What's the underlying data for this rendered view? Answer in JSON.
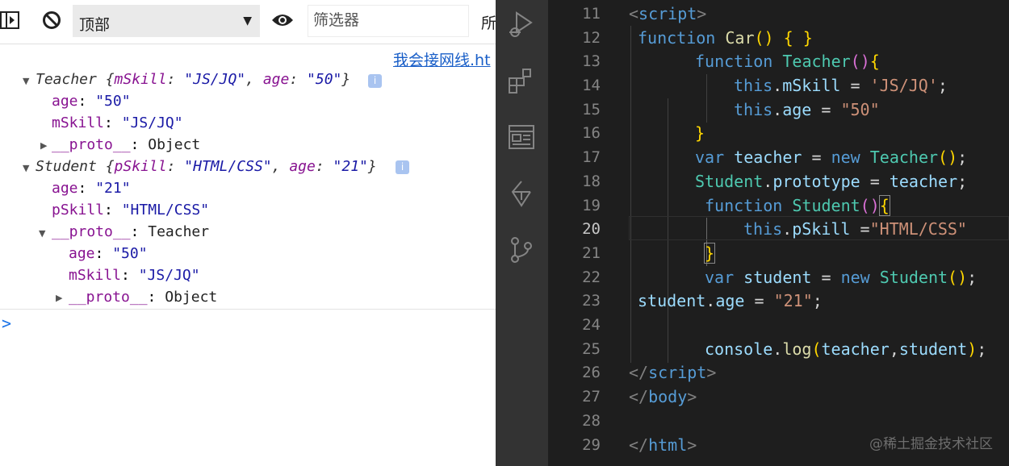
{
  "devtools": {
    "context": "顶部",
    "filter_placeholder": "筛选器",
    "levels_label": "所",
    "source_link": "我会接网线.ht",
    "log": {
      "teacher_summary": {
        "name": "Teacher ",
        "open": "{",
        "k1": "mSkill",
        "v1": "\"JS/JQ\"",
        "k2": "age",
        "v2": "\"50\"",
        "close": "}"
      },
      "teacher_props": [
        {
          "key": "age",
          "value": "\"50\""
        },
        {
          "key": "mSkill",
          "value": "\"JS/JQ\""
        }
      ],
      "teacher_proto": {
        "key": "__proto__",
        "value": "Object"
      },
      "student_summary": {
        "name": "Student ",
        "open": "{",
        "k1": "pSkill",
        "v1": "\"HTML/CSS\"",
        "k2": "age",
        "v2": "\"21\"",
        "close": "}"
      },
      "student_props": [
        {
          "key": "age",
          "value": "\"21\""
        },
        {
          "key": "pSkill",
          "value": "\"HTML/CSS\""
        }
      ],
      "student_proto": {
        "key": "__proto__",
        "value": "Teacher"
      },
      "student_proto_props": [
        {
          "key": "age",
          "value": "\"50\""
        },
        {
          "key": "mSkill",
          "value": "\"JS/JQ\""
        }
      ],
      "student_proto_proto": {
        "key": "__proto__",
        "value": "Object"
      },
      "info_glyph": "i",
      "prompt": ">"
    }
  },
  "activity_bar": [
    "run-debug-icon",
    "extensions-icon",
    "browser-preview-icon",
    "source-outline-icon",
    "source-control-icon"
  ],
  "editor": {
    "line_numbers": [
      "11",
      "12",
      "13",
      "14",
      "15",
      "16",
      "17",
      "18",
      "19",
      "20",
      "21",
      "22",
      "23",
      "24",
      "25",
      "26",
      "27",
      "28",
      "29"
    ],
    "code": {
      "l11": {
        "a": "<",
        "b": "script",
        "c": ">"
      },
      "l12": {
        "a": "function",
        "b": "Car",
        "c": "()",
        "d": " { }"
      },
      "l13": {
        "a": "function",
        "b": "Teacher",
        "c": "()",
        "d": "{"
      },
      "l14": {
        "a": "this",
        "b": ".",
        "c": "mSkill",
        "d": " = ",
        "e": "'JS/JQ'",
        "f": ";"
      },
      "l15": {
        "a": "this",
        "b": ".",
        "c": "age",
        "d": " = ",
        "e": "\"50\""
      },
      "l16": {
        "a": "}"
      },
      "l17": {
        "a": "var",
        "b": " teacher",
        "c": " = ",
        "d": "new",
        "e": " Teacher",
        "f": "()",
        "g": ";"
      },
      "l18": {
        "a": "Student",
        "b": ".",
        "c": "prototype",
        "d": " = ",
        "e": "teacher",
        "f": ";"
      },
      "l19": {
        "a": "function",
        "b": "Student",
        "c": "()",
        "d": "{"
      },
      "l20": {
        "a": "this",
        "b": ".",
        "c": "pSkill",
        "d": " =",
        "e": "\"HTML/CSS\""
      },
      "l21": {
        "a": "}"
      },
      "l22": {
        "a": "var",
        "b": " student",
        "c": " = ",
        "d": "new",
        "e": " Student",
        "f": "()",
        "g": ";"
      },
      "l23": {
        "a": "student",
        "b": ".",
        "c": "age",
        "d": " = ",
        "e": "\"21\"",
        "f": ";"
      },
      "l25": {
        "a": "console",
        "b": ".",
        "c": "log",
        "d": "(",
        "e": "teacher",
        "f": ",",
        "g": "student",
        "h": ")",
        "i": ";"
      },
      "l26": {
        "a": "</",
        "b": "script",
        "c": ">"
      },
      "l27": {
        "a": "</",
        "b": "body",
        "c": ">"
      },
      "l29": {
        "a": "</",
        "b": "html",
        "c": ">"
      }
    },
    "watermark": "@稀土掘金技术社区"
  }
}
